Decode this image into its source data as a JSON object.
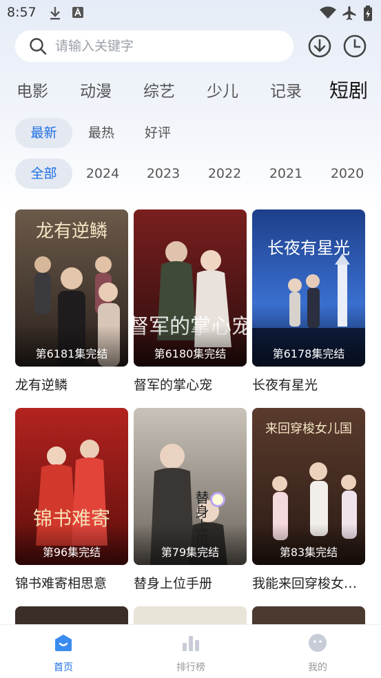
{
  "status_bar": {
    "time": "8:57",
    "icons": [
      "download-icon",
      "a-notification-icon",
      "wifi-icon",
      "airplane-icon",
      "battery-icon"
    ]
  },
  "search": {
    "placeholder": "请输入关键字",
    "value": ""
  },
  "header_buttons": [
    "download-icon",
    "history-clock-icon"
  ],
  "category_tabs": [
    {
      "label": "电影",
      "active": false
    },
    {
      "label": "动漫",
      "active": false
    },
    {
      "label": "综艺",
      "active": false
    },
    {
      "label": "少儿",
      "active": false
    },
    {
      "label": "记录",
      "active": false
    },
    {
      "label": "短剧",
      "active": true
    }
  ],
  "sort_filters": [
    {
      "label": "最新",
      "active": true
    },
    {
      "label": "最热",
      "active": false
    },
    {
      "label": "好评",
      "active": false
    }
  ],
  "year_filters": [
    {
      "label": "全部",
      "active": true
    },
    {
      "label": "2024",
      "active": false
    },
    {
      "label": "2023",
      "active": false
    },
    {
      "label": "2022",
      "active": false
    },
    {
      "label": "2021",
      "active": false
    },
    {
      "label": "2020",
      "active": false
    }
  ],
  "items": [
    {
      "title": "龙有逆鳞",
      "badge": "第6181集完结",
      "poster_text": "龙有逆鳞"
    },
    {
      "title": "督军的掌心宠",
      "badge": "第6180集完结",
      "poster_text": "督军的掌心宠"
    },
    {
      "title": "长夜有星光",
      "badge": "第6178集完结",
      "poster_text": "长夜有星光"
    },
    {
      "title": "锦书难寄相思意",
      "badge": "第96集完结",
      "poster_text": "锦书难寄"
    },
    {
      "title": "替身上位手册",
      "badge": "第79集完结",
      "poster_text": "替身上位手"
    },
    {
      "title": "我能来回穿梭女儿国",
      "badge": "第83集完结",
      "poster_text": "来回穿梭女儿国"
    }
  ],
  "bottom_nav": [
    {
      "label": "首页",
      "icon": "home-icon",
      "active": true
    },
    {
      "label": "排行榜",
      "icon": "ranking-chart-icon",
      "active": false
    },
    {
      "label": "我的",
      "icon": "profile-face-icon",
      "active": false
    }
  ],
  "colors": {
    "accent": "#1f6fe5",
    "pill_bg": "#e3e8f1",
    "nav_inactive": "#999999"
  }
}
